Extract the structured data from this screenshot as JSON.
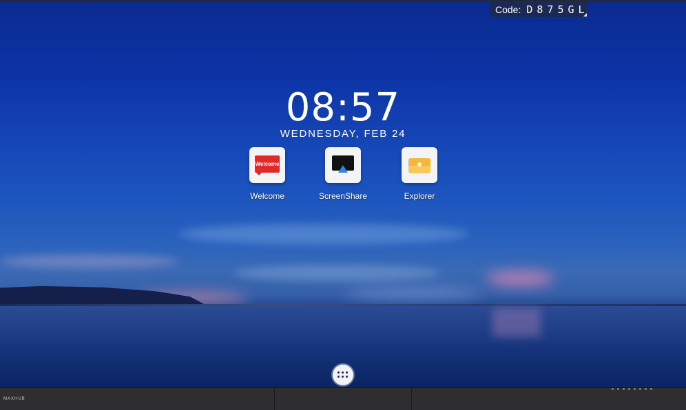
{
  "code_badge": {
    "label": "Code:",
    "value": "D875GL"
  },
  "clock": {
    "time": "08:57",
    "date": "WEDNESDAY, FEB 24"
  },
  "apps": [
    {
      "label": "Welcome",
      "icon": "welcome-card-icon",
      "tile_text": "Welcome"
    },
    {
      "label": "ScreenShare",
      "icon": "screenshare-icon"
    },
    {
      "label": "Explorer",
      "icon": "folder-icon"
    }
  ],
  "drawer": {
    "icon": "app-grid-icon"
  },
  "bezel": {
    "brand": "MAXHUB"
  },
  "colors": {
    "badge_bg": "#1b2a55",
    "welcome_red": "#e02a2a",
    "screenshare_blue": "#2f86e0",
    "folder_yellow": "#f8c85a"
  }
}
